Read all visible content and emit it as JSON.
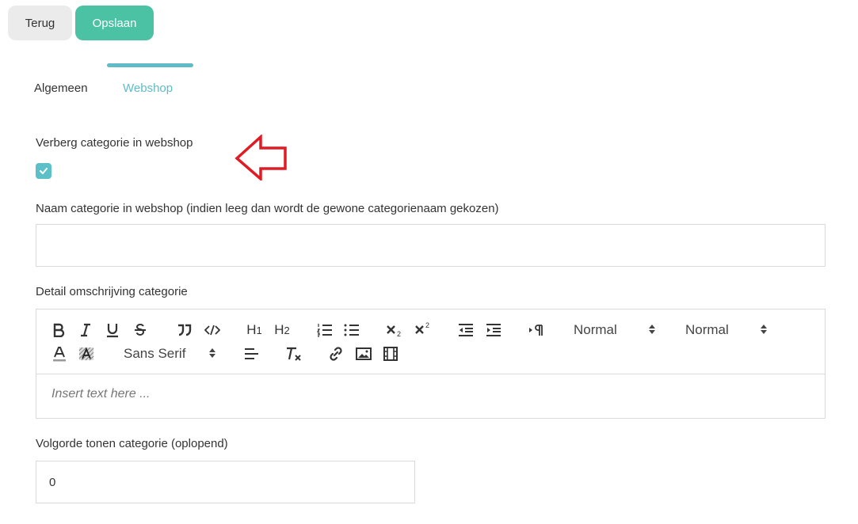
{
  "header": {
    "back_label": "Terug",
    "save_label": "Opslaan"
  },
  "tabs": [
    {
      "label": "Algemeen",
      "active": false
    },
    {
      "label": "Webshop",
      "active": true
    }
  ],
  "form": {
    "hide_label": "Verberg categorie in webshop",
    "hide_checked": true,
    "name_label": "Naam categorie in webshop (indien leeg dan wordt de gewone categorienaam gekozen)",
    "name_value": "",
    "description_label": "Detail omschrijving categorie",
    "description_placeholder": "Insert text here ...",
    "order_label": "Volgorde tonen categorie (oplopend)",
    "order_value": "0"
  },
  "editor_toolbar": {
    "header_select": "Normal",
    "size_select": "Normal",
    "font_select": "Sans Serif",
    "h1": "H1",
    "h2": "H2"
  },
  "colors": {
    "accent": "#4cc2a4",
    "tab_active": "#5fbcc6",
    "checkbox": "#5bc0c8",
    "annotation_arrow": "#e01b24"
  }
}
